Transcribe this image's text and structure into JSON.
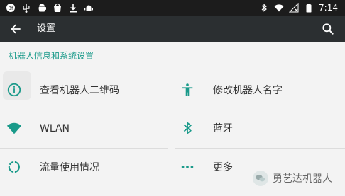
{
  "status_bar": {
    "left_icons": [
      "notification-badge-icon",
      "usb-icon",
      "android-icon",
      "store-icon",
      "download-icon",
      "android-debug-icon"
    ],
    "right_icons": [
      "bluetooth-icon",
      "wifi-icon",
      "signal-off-icon",
      "battery-icon"
    ],
    "time": "7:14"
  },
  "toolbar": {
    "back_icon": "arrow-left-icon",
    "title": "设置",
    "search_icon": "search-icon"
  },
  "section": {
    "title": "机器人信息和系统设置"
  },
  "items": [
    {
      "label": "查看机器人二维码",
      "icon": "info-icon"
    },
    {
      "label": "修改机器人名字",
      "icon": "accessibility-icon"
    },
    {
      "label": "WLAN",
      "icon": "wifi-icon"
    },
    {
      "label": "蓝牙",
      "icon": "bluetooth-icon"
    },
    {
      "label": "流量使用情况",
      "icon": "data-usage-icon"
    },
    {
      "label": "更多",
      "icon": "more-horizontal-icon"
    }
  ],
  "watermark": {
    "text": "勇艺达机器人"
  },
  "colors": {
    "accent": "#1a9a8a",
    "toolbar": "#2b2f31",
    "status_bar": "#1c1c1c",
    "background": "#f3f3f3"
  }
}
